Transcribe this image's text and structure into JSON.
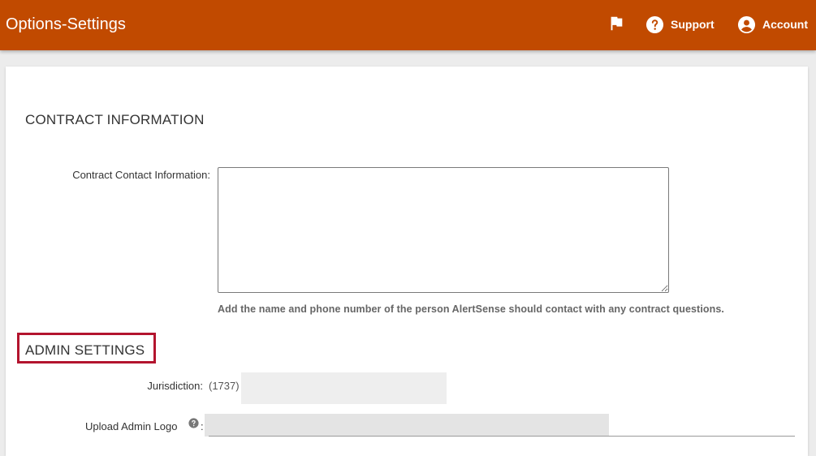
{
  "header": {
    "title": "Options-Settings",
    "support_label": "Support",
    "account_label": "Account",
    "background_color": "#c14a00",
    "icons": [
      "flag-icon",
      "help-circle-icon",
      "account-circle-icon"
    ]
  },
  "contract_section": {
    "heading": "CONTRACT INFORMATION",
    "contact_label": "Contract Contact Information:",
    "contact_value": "",
    "help_text": "Add the name and phone number of the person AlertSense should contact with any contract questions."
  },
  "admin_section": {
    "heading": "ADMIN SETTINGS",
    "highlight_color": "#b3142e",
    "jurisdiction_label": "Jurisdiction:",
    "jurisdiction_value": "(1737)",
    "upload_logo_label": "Upload Admin Logo",
    "upload_logo_colon": ":"
  }
}
